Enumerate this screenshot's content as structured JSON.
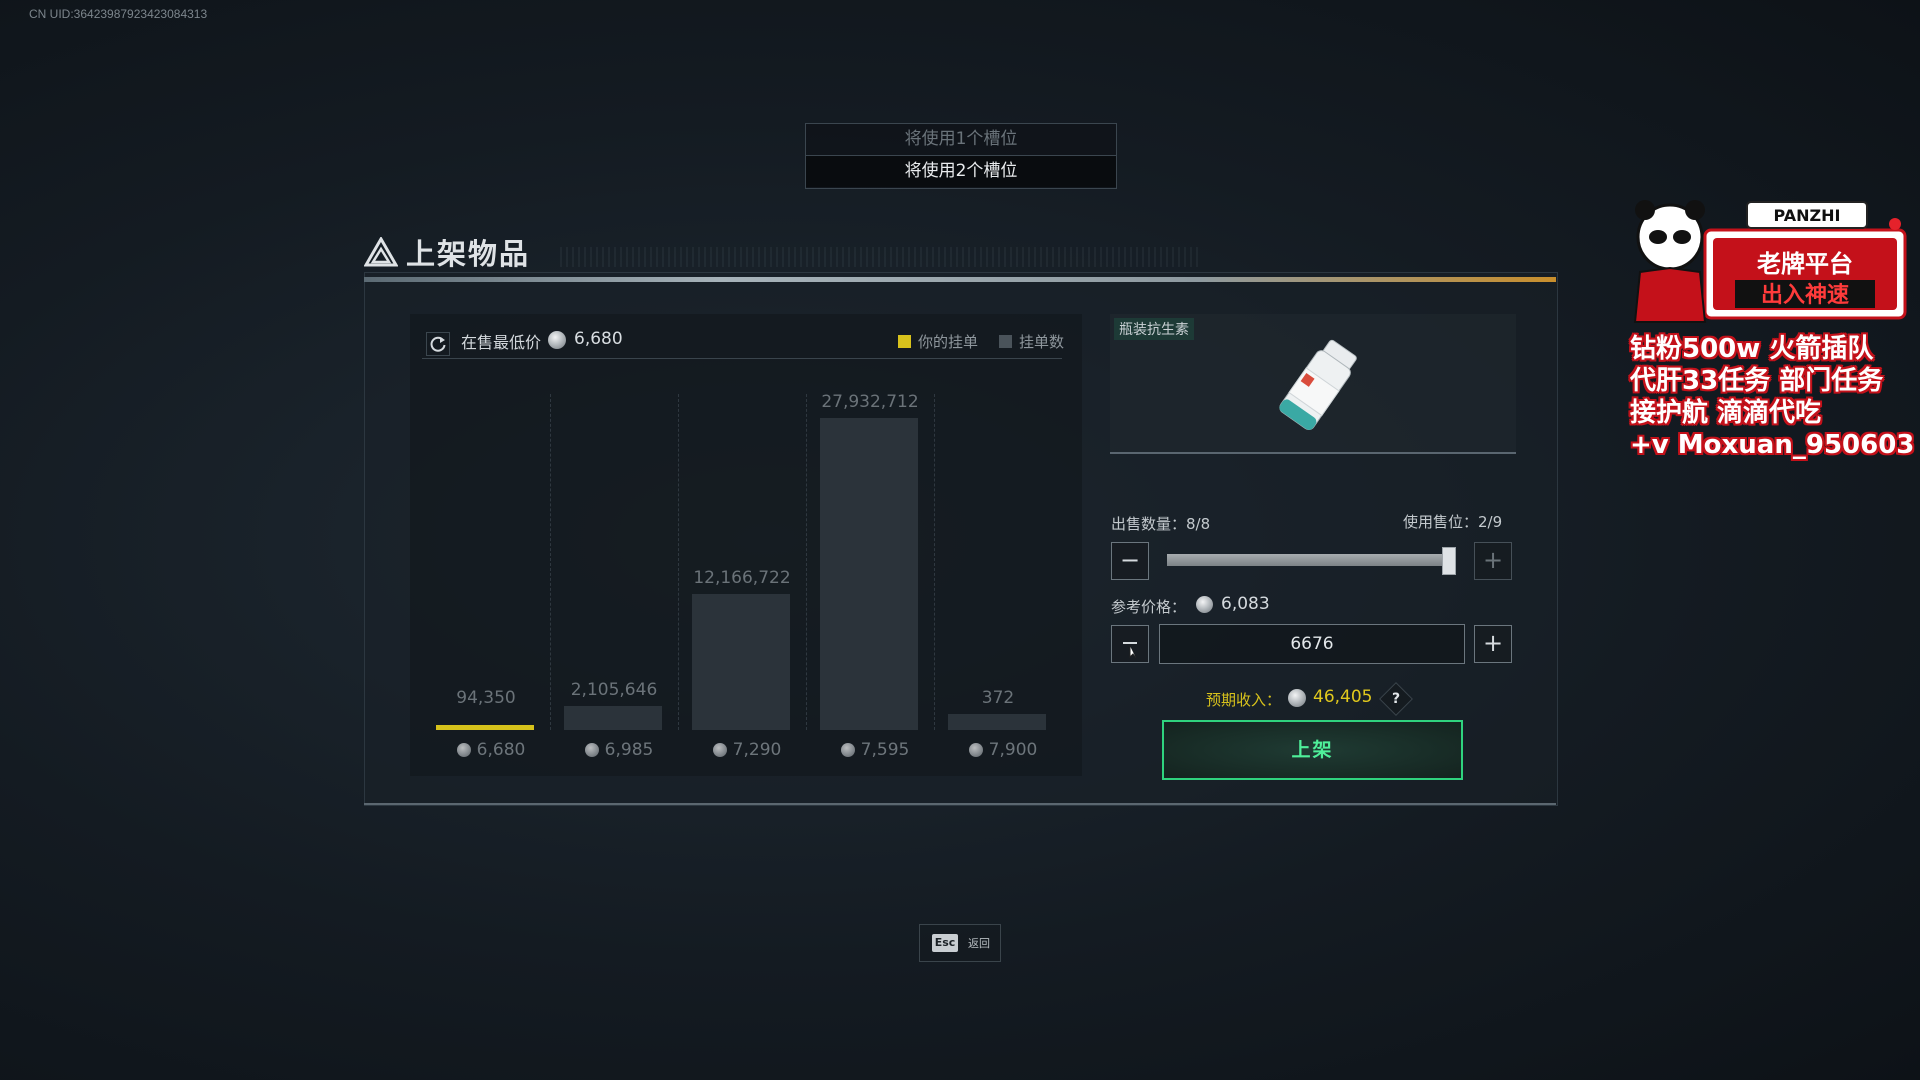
{
  "uid": "CN UID:36423987923423084313",
  "slots": {
    "option1": "将使用1个槽位",
    "option2": "将使用2个槽位"
  },
  "title": "上架物品",
  "market": {
    "lowest_label": "在售最低价",
    "lowest_value": "6,680",
    "legend_your": "你的挂单",
    "legend_count": "挂单数"
  },
  "chart_data": {
    "type": "bar",
    "categories": [
      "6,680",
      "6,985",
      "7,290",
      "7,595",
      "7,900"
    ],
    "series": [
      {
        "name": "挂单数",
        "values": [
          94350,
          2105646,
          12166722,
          27932712,
          372
        ]
      }
    ],
    "value_labels": [
      "94,350",
      "2,105,646",
      "12,166,722",
      "27,932,712",
      "372"
    ],
    "highlight_index": 0,
    "highlight_color": "#d6c21b",
    "bar_color": "#2b333a"
  },
  "item": {
    "name": "瓶装抗生素"
  },
  "controls": {
    "sell_qty_label": "出售数量：8/8",
    "slot_usage_label": "使用售位：2/9",
    "qty_fraction": 1.0,
    "ref_price_label": "参考价格：",
    "ref_price_value": "6,083",
    "price_input_value": "6676",
    "income_label": "预期收入：",
    "income_value": "46,405",
    "help": "?",
    "list_button": "上架"
  },
  "esc": {
    "key": "Esc",
    "label": "返回"
  },
  "overlay": {
    "brand": "PANZHI",
    "logo_line1": "老牌平台",
    "logo_line2": "出入神速",
    "lines": [
      "钻粉500w 火箭插队",
      "代肝33任务 部门任务",
      "接护航 滴滴代吃",
      "+v Moxuan_950603"
    ]
  },
  "colors": {
    "accent_yellow": "#d8c21c",
    "accent_green": "#2fd37e",
    "overlay_red": "#c4111a"
  }
}
